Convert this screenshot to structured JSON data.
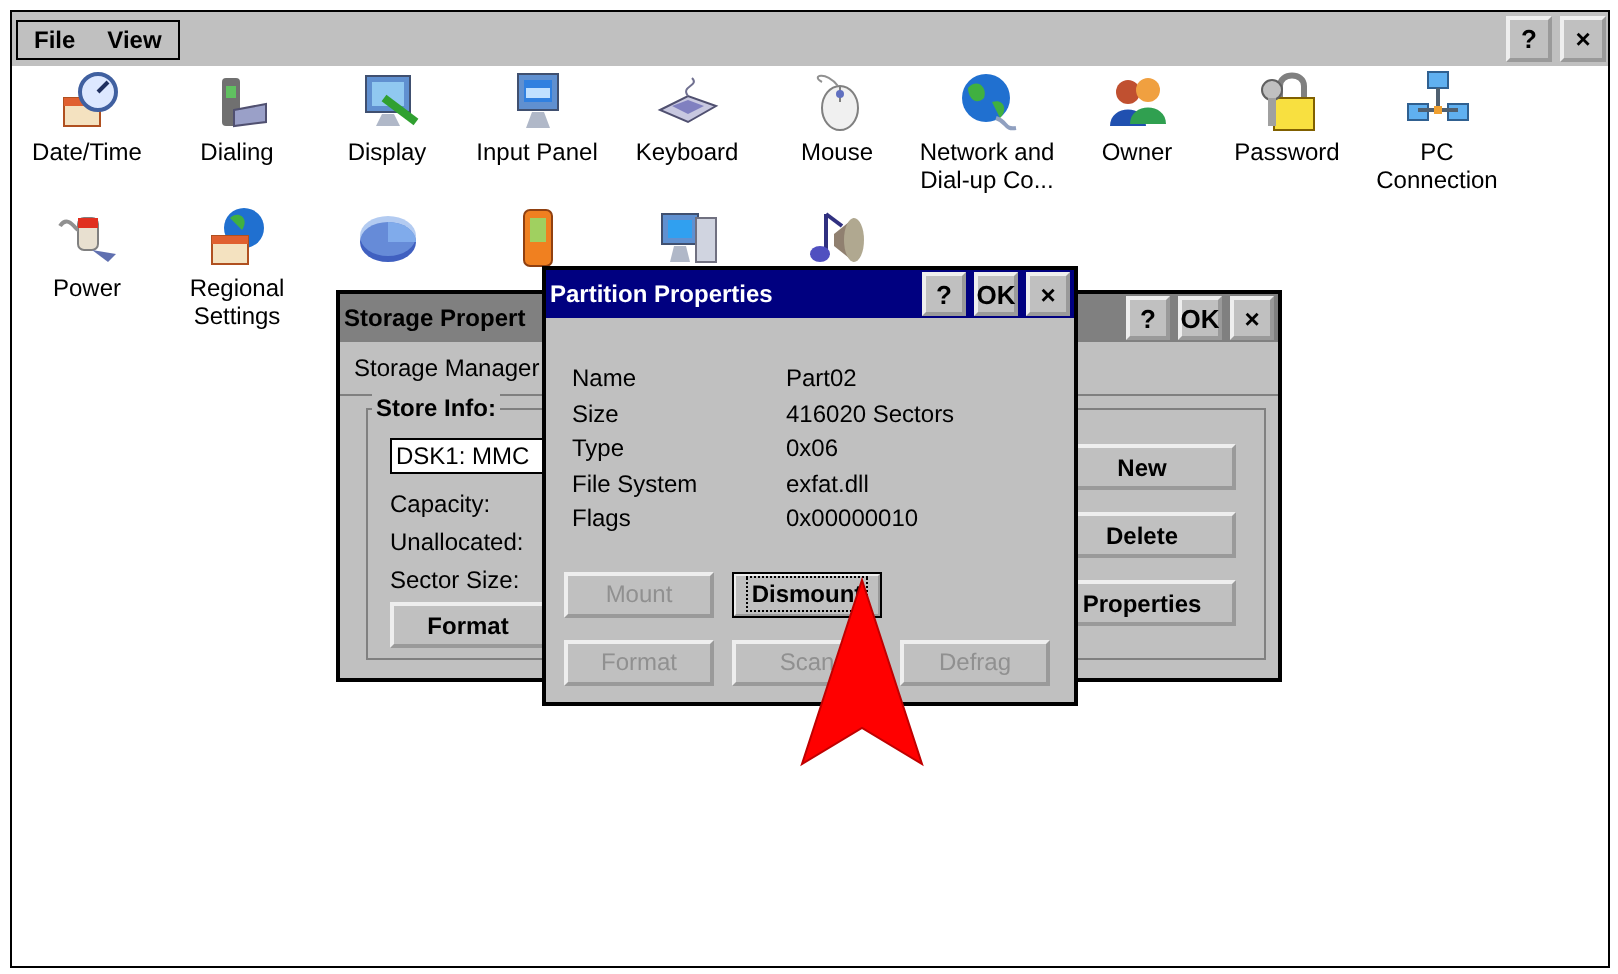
{
  "menu": [
    {
      "label": "File"
    },
    {
      "label": "View"
    }
  ],
  "frame_buttons": [
    "?",
    "×"
  ],
  "icons": [
    {
      "kind": "labeled",
      "label": "Date/Time"
    },
    {
      "kind": "labeled",
      "label": "Dialing"
    },
    {
      "kind": "labeled",
      "label": "Display"
    },
    {
      "kind": "labeled",
      "label": "Input Panel"
    },
    {
      "kind": "labeled",
      "label": "Keyboard"
    },
    {
      "kind": "labeled",
      "label": "Mouse"
    },
    {
      "kind": "labeled",
      "label": "Network and Dial-up Co..."
    },
    {
      "kind": "labeled",
      "label": "Owner"
    },
    {
      "kind": "labeled",
      "label": "Password"
    },
    {
      "kind": "labeled",
      "label": "PC Connection"
    },
    {
      "kind": "labeled",
      "label": "Power"
    },
    {
      "kind": "labeled",
      "label": "Regional Settings"
    },
    {
      "kind": "covered"
    },
    {
      "kind": "covered"
    },
    {
      "kind": "covered"
    },
    {
      "kind": "covered"
    }
  ],
  "storage_window": {
    "title": "Storage Propert",
    "active": false,
    "title_buttons": [
      "?",
      "OK",
      "×"
    ],
    "tab": "Storage Manager",
    "group_title": "Store Info:",
    "store": "DSK1: MMC",
    "fields": [
      "Capacity:",
      "Unallocated:",
      "Sector Size:"
    ],
    "format_button": {
      "label": "Format",
      "disabled": false
    },
    "side_buttons": [
      {
        "label": "New",
        "disabled": false
      },
      {
        "label": "Delete",
        "disabled": false
      },
      {
        "label": "Properties",
        "disabled": false
      }
    ]
  },
  "partition_window": {
    "title": "Partition Properties",
    "active": true,
    "title_buttons": [
      "?",
      "OK",
      "×"
    ],
    "properties": [
      {
        "name": "Name",
        "value": "Part02"
      },
      {
        "name": "Size",
        "value": "416020 Sectors"
      },
      {
        "name": "Type",
        "value": "0x06"
      },
      {
        "name": "File System",
        "value": "exfat.dll"
      },
      {
        "name": "Flags",
        "value": "0x00000010"
      }
    ],
    "buttons": [
      {
        "label": "Mount",
        "disabled": true,
        "focused": false
      },
      {
        "label": "Dismount",
        "disabled": false,
        "focused": true
      },
      {
        "label": "Format",
        "disabled": true,
        "focused": false
      },
      {
        "label": "Scan",
        "disabled": true,
        "focused": false
      },
      {
        "label": "Defrag",
        "disabled": true,
        "focused": false
      }
    ]
  }
}
